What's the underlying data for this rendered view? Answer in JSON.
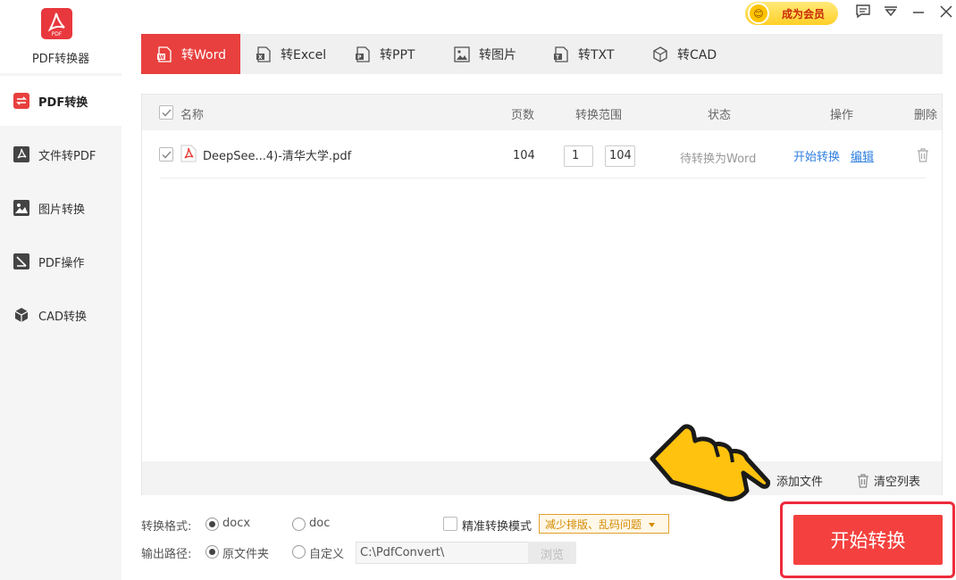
{
  "app": {
    "logo_text": "PDF",
    "name": "PDF转换器"
  },
  "sidebar": {
    "items": [
      {
        "label": "PDF转换",
        "icon": "convert-icon",
        "active": true
      },
      {
        "label": "文件转PDF",
        "icon": "pdf-file-icon",
        "active": false
      },
      {
        "label": "图片转换",
        "icon": "image-icon",
        "active": false
      },
      {
        "label": "PDF操作",
        "icon": "pdf-edit-icon",
        "active": false
      },
      {
        "label": "CAD转换",
        "icon": "cube-icon",
        "active": false
      }
    ]
  },
  "topbar": {
    "vip_face": "😊",
    "vip_label": "成为会员",
    "icons": [
      "message-icon",
      "dropdown-icon",
      "minimize-icon",
      "close-icon"
    ]
  },
  "tabs": [
    {
      "label": "转Word",
      "icon": "word-icon",
      "active": true
    },
    {
      "label": "转Excel",
      "icon": "excel-icon",
      "active": false
    },
    {
      "label": "转PPT",
      "icon": "ppt-icon",
      "active": false
    },
    {
      "label": "转图片",
      "icon": "picture-icon",
      "active": false
    },
    {
      "label": "转TXT",
      "icon": "txt-icon",
      "active": false
    },
    {
      "label": "转CAD",
      "icon": "cad-icon",
      "active": false
    }
  ],
  "table": {
    "headers": {
      "name": "名称",
      "pages": "页数",
      "range": "转换范围",
      "status": "状态",
      "actions": "操作",
      "delete": "删除"
    },
    "rows": [
      {
        "checked": true,
        "file_name": "DeepSee...4)-清华大学.pdf",
        "pages": "104",
        "range_from": "1",
        "range_to": "104",
        "status": "待转换为Word",
        "action_start": "开始转换",
        "action_edit": "编辑"
      }
    ]
  },
  "footer": {
    "add_file": "添加文件",
    "clear_list": "清空列表"
  },
  "options": {
    "format_label": "转换格式:",
    "format_docx": "docx",
    "format_doc": "doc",
    "format_selected": "docx",
    "precise_label": "精准转换模式",
    "precise_tip": "减少排版、乱码问题",
    "output_label": "输出路径:",
    "output_original": "原文件夹",
    "output_custom": "自定义",
    "output_path": "C:\\PdfConvert\\",
    "browse": "浏览"
  },
  "start_button": "开始转换",
  "colors": {
    "accent": "#e8403e",
    "link": "#2f7fe0",
    "vip": "#ffd028"
  }
}
